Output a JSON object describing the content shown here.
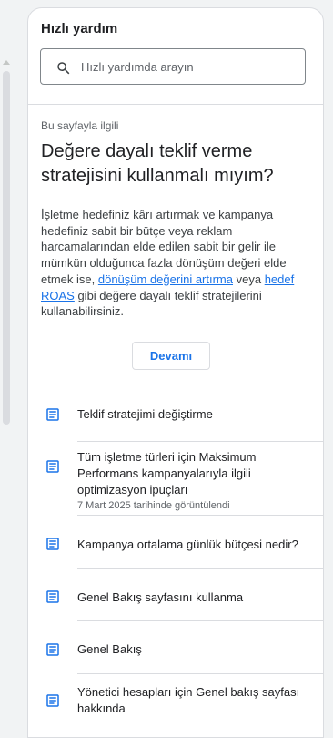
{
  "panel": {
    "title": "Hızlı yardım"
  },
  "search": {
    "placeholder": "Hızlı yardımda arayın",
    "icon": "search-icon"
  },
  "article": {
    "section_label": "Bu sayfayla ilgili",
    "title": "Değere dayalı teklif verme stratejisini kullanmalı mıyım?",
    "body_part1": "İşletme hedefiniz kârı artırmak ve kampanya hedefiniz sabit bir bütçe veya reklam harcamalarından elde edilen sabit bir gelir ile mümkün olduğunca fazla dönüşüm değeri elde etmek ise, ",
    "link1": "dönüşüm değerini artırma",
    "body_part2": " veya ",
    "link2": "hedef ROAS",
    "body_part3": " gibi değere dayalı teklif stratejilerini kullanabilirsiniz.",
    "more_label": "Devamı"
  },
  "related_items": [
    {
      "label": "Teklif stratejimi değiştirme",
      "date": "",
      "icon": "article-icon"
    },
    {
      "label": "Tüm işletme türleri için Maksimum Performans kampanyalarıyla ilgili optimizasyon ipuçları",
      "date": "7 Mart 2025 tarihinde görüntülendi",
      "icon": "article-icon"
    },
    {
      "label": "Kampanya ortalama günlük bütçesi nedir?",
      "date": "",
      "icon": "article-icon"
    },
    {
      "label": "Genel Bakış sayfasını kullanma",
      "date": "",
      "icon": "article-icon"
    },
    {
      "label": "Genel Bakış",
      "date": "",
      "icon": "article-icon"
    },
    {
      "label": "Yönetici hesapları için Genel bakış sayfası hakkında",
      "date": "",
      "icon": "article-icon"
    }
  ],
  "colors": {
    "accent": "#1a73e8",
    "icon": "#1a73e8",
    "divider": "#dadce0"
  }
}
